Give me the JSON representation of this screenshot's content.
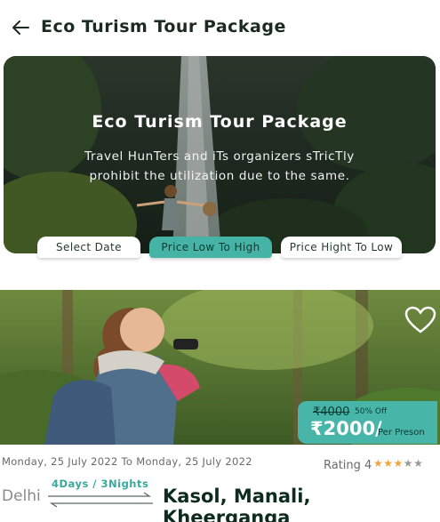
{
  "header": {
    "title": "Eco Turism Tour Package",
    "back_icon": "arrow-left-icon"
  },
  "hero": {
    "title": "Eco Turism Tour Package",
    "description_line1": "Travel HunTers and iTs organizers sTricTly",
    "description_line2": "prohibit the utilization due to the same."
  },
  "filters": {
    "select_date": "Select Date",
    "price_low_high": "Price Low To High",
    "price_high_low": "Price Hight To Low",
    "active": "price_low_high"
  },
  "card": {
    "favorite_icon": "heart-outline-icon",
    "old_price": "₹4000",
    "discount": "50% Off",
    "price": "₹2000/",
    "price_unit": "Per Preson",
    "dates": "Monday, 25 July 2022  To Monday, 25 July 2022",
    "rating_label": "Rating 4",
    "rating_value": 4,
    "rating_max": 5,
    "origin": "Delhi",
    "duration": "4Days / 3Nights",
    "destination": "Kasol, Manali, Kheerganga"
  },
  "colors": {
    "accent": "#48b5a9",
    "star": "#f0a43b",
    "text_dark": "#1b2a22"
  }
}
